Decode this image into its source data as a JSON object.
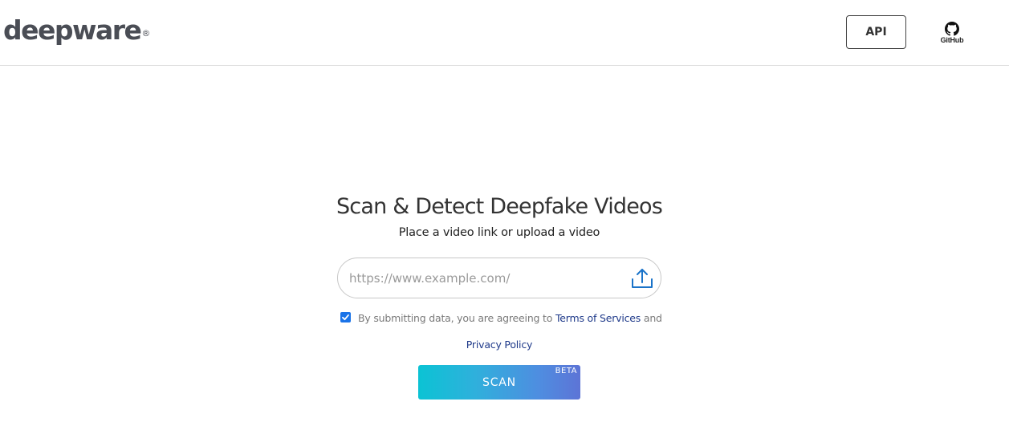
{
  "header": {
    "logo_text": "deepware",
    "logo_mark": "®",
    "api_label": "API",
    "github_label": "GitHub",
    "github_icon": "github-icon"
  },
  "main": {
    "title": "Scan & Detect Deepfake Videos",
    "subtitle": "Place a video link or upload a video",
    "url_input": {
      "placeholder": "https://www.example.com/",
      "value": ""
    },
    "upload_icon": "upload-icon",
    "agreement": {
      "checked": true,
      "prefix": "By submitting data, you are agreeing to ",
      "terms_link": "Terms of Services",
      "suffix": " and",
      "privacy_link": "Privacy Policy"
    },
    "scan_button": {
      "label": "SCAN",
      "badge": "BETA"
    }
  },
  "colors": {
    "checkbox": "#1a73e8",
    "link": "#1f3a8a",
    "scan_gradient_start": "#0bc3d4",
    "scan_gradient_end": "#5d74d6",
    "upload_icon": "#1a73c9"
  }
}
